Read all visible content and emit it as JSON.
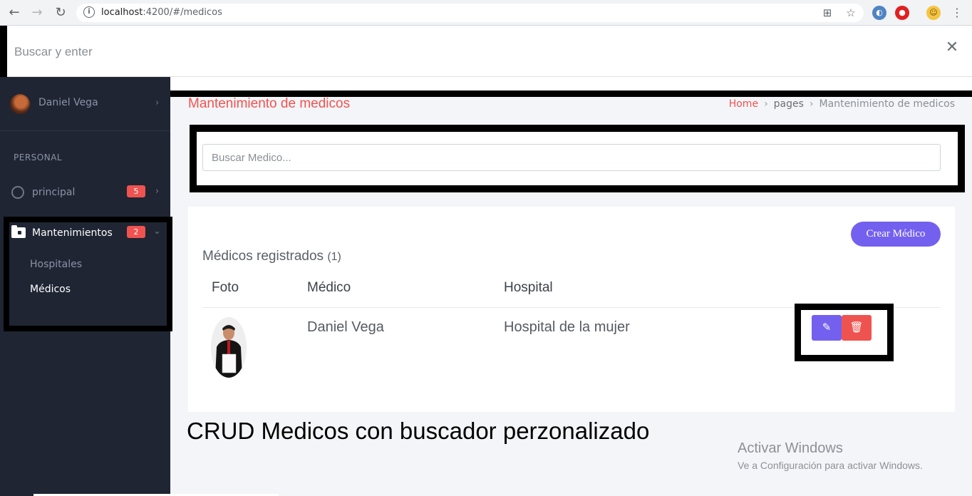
{
  "browser": {
    "url_host": "localhost",
    "url_path": ":4200/#/medicos"
  },
  "top_search": {
    "placeholder": "Buscar y enter"
  },
  "sidebar": {
    "user_name": "Daniel Vega",
    "section_title": "PERSONAL",
    "items": [
      {
        "label": "principal",
        "badge": "5"
      },
      {
        "label": "Mantenimientos",
        "badge": "2"
      }
    ],
    "subitems": [
      {
        "label": "Hospitales"
      },
      {
        "label": "Médicos"
      }
    ]
  },
  "page": {
    "title": "Mantenimiento de medicos",
    "breadcrumb": [
      "Home",
      "pages",
      "Mantenimiento de medicos"
    ]
  },
  "search": {
    "placeholder": "Buscar Medico..."
  },
  "table": {
    "create_button": "Crear Médico",
    "title": "Médicos registrados",
    "count": "(1)",
    "headers": [
      "Foto",
      "Médico",
      "Hospital"
    ],
    "rows": [
      {
        "medico": "Daniel Vega",
        "hospital": "Hospital de la mujer"
      }
    ]
  },
  "caption": "CRUD Medicos con buscador perzonalizado",
  "watermark": {
    "line1": "Activar Windows",
    "line2": "Ve a Configuración para activar Windows."
  },
  "colors": {
    "accent_red": "#ef5350",
    "accent_purple": "#7460ee",
    "sidebar_bg": "#1f2533"
  }
}
